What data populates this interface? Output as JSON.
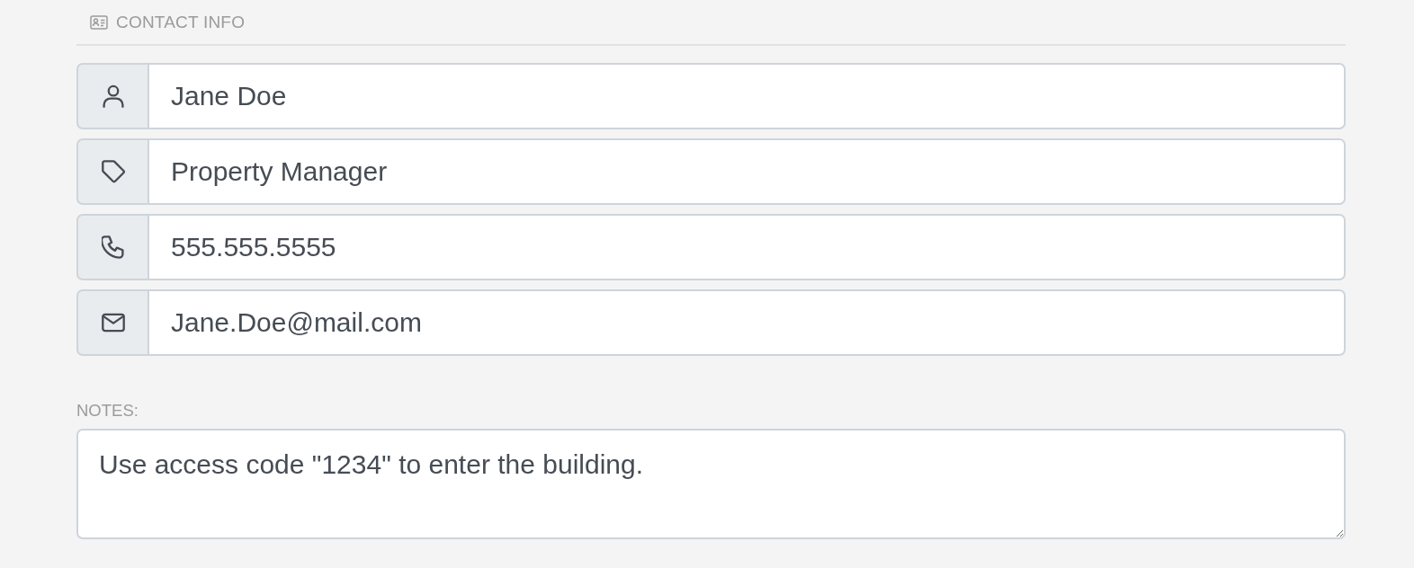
{
  "section": {
    "title": "CONTACT INFO"
  },
  "fields": [
    {
      "kind": "person",
      "value": "Jane Doe"
    },
    {
      "kind": "tag",
      "value": "Property Manager"
    },
    {
      "kind": "phone",
      "value": "555.555.5555"
    },
    {
      "kind": "email",
      "value": "Jane.Doe@mail.com"
    }
  ],
  "notes": {
    "label": "NOTES:",
    "value": "Use access code \"1234\" to enter the building."
  }
}
